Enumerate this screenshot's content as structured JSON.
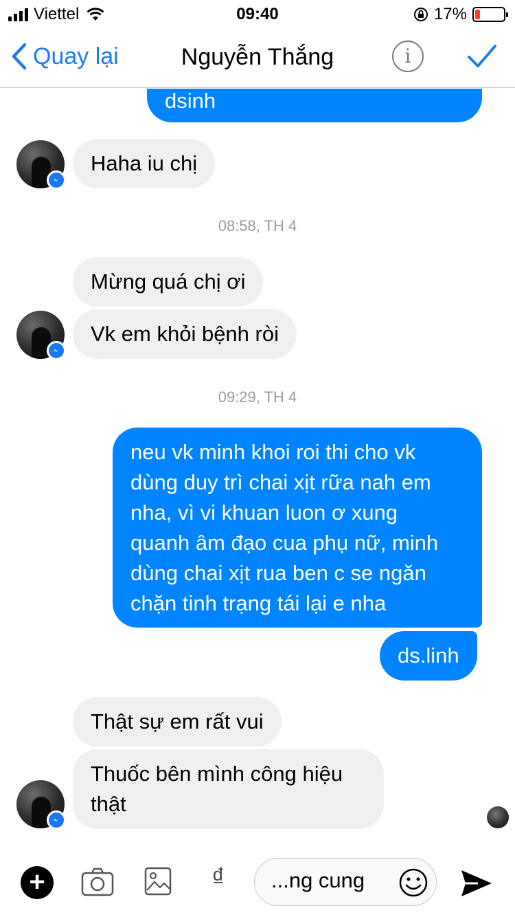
{
  "status_bar": {
    "carrier": "Viettel",
    "time": "09:40",
    "battery_percent": "17%",
    "battery_level": 0.17,
    "icons": [
      "signal-icon",
      "wifi-icon",
      "orientation-lock-icon",
      "battery-icon"
    ]
  },
  "nav": {
    "back_label": "Quay lại",
    "title": "Nguyễn Thắng",
    "info_icon": "info-icon",
    "done_icon": "checkmark-icon"
  },
  "messages": {
    "m0": "dsinh",
    "m1": "Haha iu chị",
    "ts1": "08:58, TH 4",
    "m2": "Mừng quá chị ơi",
    "m3": "Vk em khỏi bệnh ròi",
    "ts2": "09:29, TH 4",
    "m4": [
      "neu vk minh khoi roi thi cho vk",
      "dùng duy trì chai xịt rữa nah em",
      "nha, vì vi khuan luon ơ xung",
      "quanh âm đạo cua phụ nữ, minh",
      "dùng chai xịt rua ben c se ngăn",
      "chặn tinh trạng tái lại e nha"
    ],
    "m5": "ds.linh",
    "m6": "Thật sự em rất vui",
    "m7": [
      "Thuốc bên mình công hiệu",
      "thật"
    ]
  },
  "composer": {
    "input_text": "...ng cung",
    "dong_symbol": "₫",
    "plus_symbol": "+",
    "icons": [
      "plus-icon",
      "camera-icon",
      "gallery-icon",
      "dong-icon",
      "emoji-icon",
      "send-icon"
    ]
  },
  "colors": {
    "accent": "#1d7bf2",
    "outgoing_bubble": "#0084ff",
    "incoming_bubble": "#f0f0f0",
    "timestamp": "#9b9b9b",
    "battery_low": "#ff3b30"
  }
}
